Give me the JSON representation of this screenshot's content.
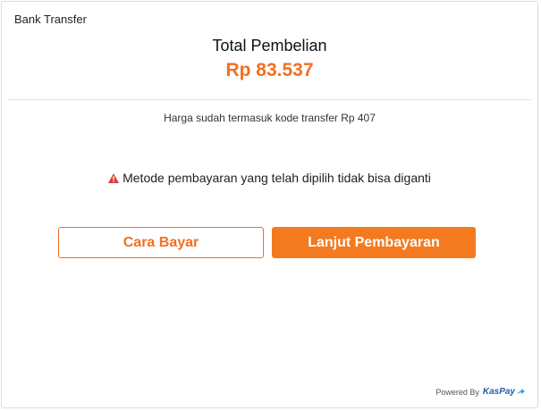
{
  "payment": {
    "method_title": "Bank Transfer",
    "total_label": "Total Pembelian",
    "total_amount": "Rp 83.537",
    "fee_note": "Harga sudah termasuk kode transfer Rp 407",
    "warning_text": "Metode pembayaran yang telah dipilih tidak bisa diganti",
    "warning_icon": "warning-triangle-icon"
  },
  "buttons": {
    "how_to_pay": "Cara Bayar",
    "continue_payment": "Lanjut Pembayaran"
  },
  "footer": {
    "powered_by": "Powered By",
    "brand": "KasPay"
  },
  "colors": {
    "accent": "#f36f21",
    "warning": "#e03b3b",
    "brand": "#1e5fa8"
  }
}
